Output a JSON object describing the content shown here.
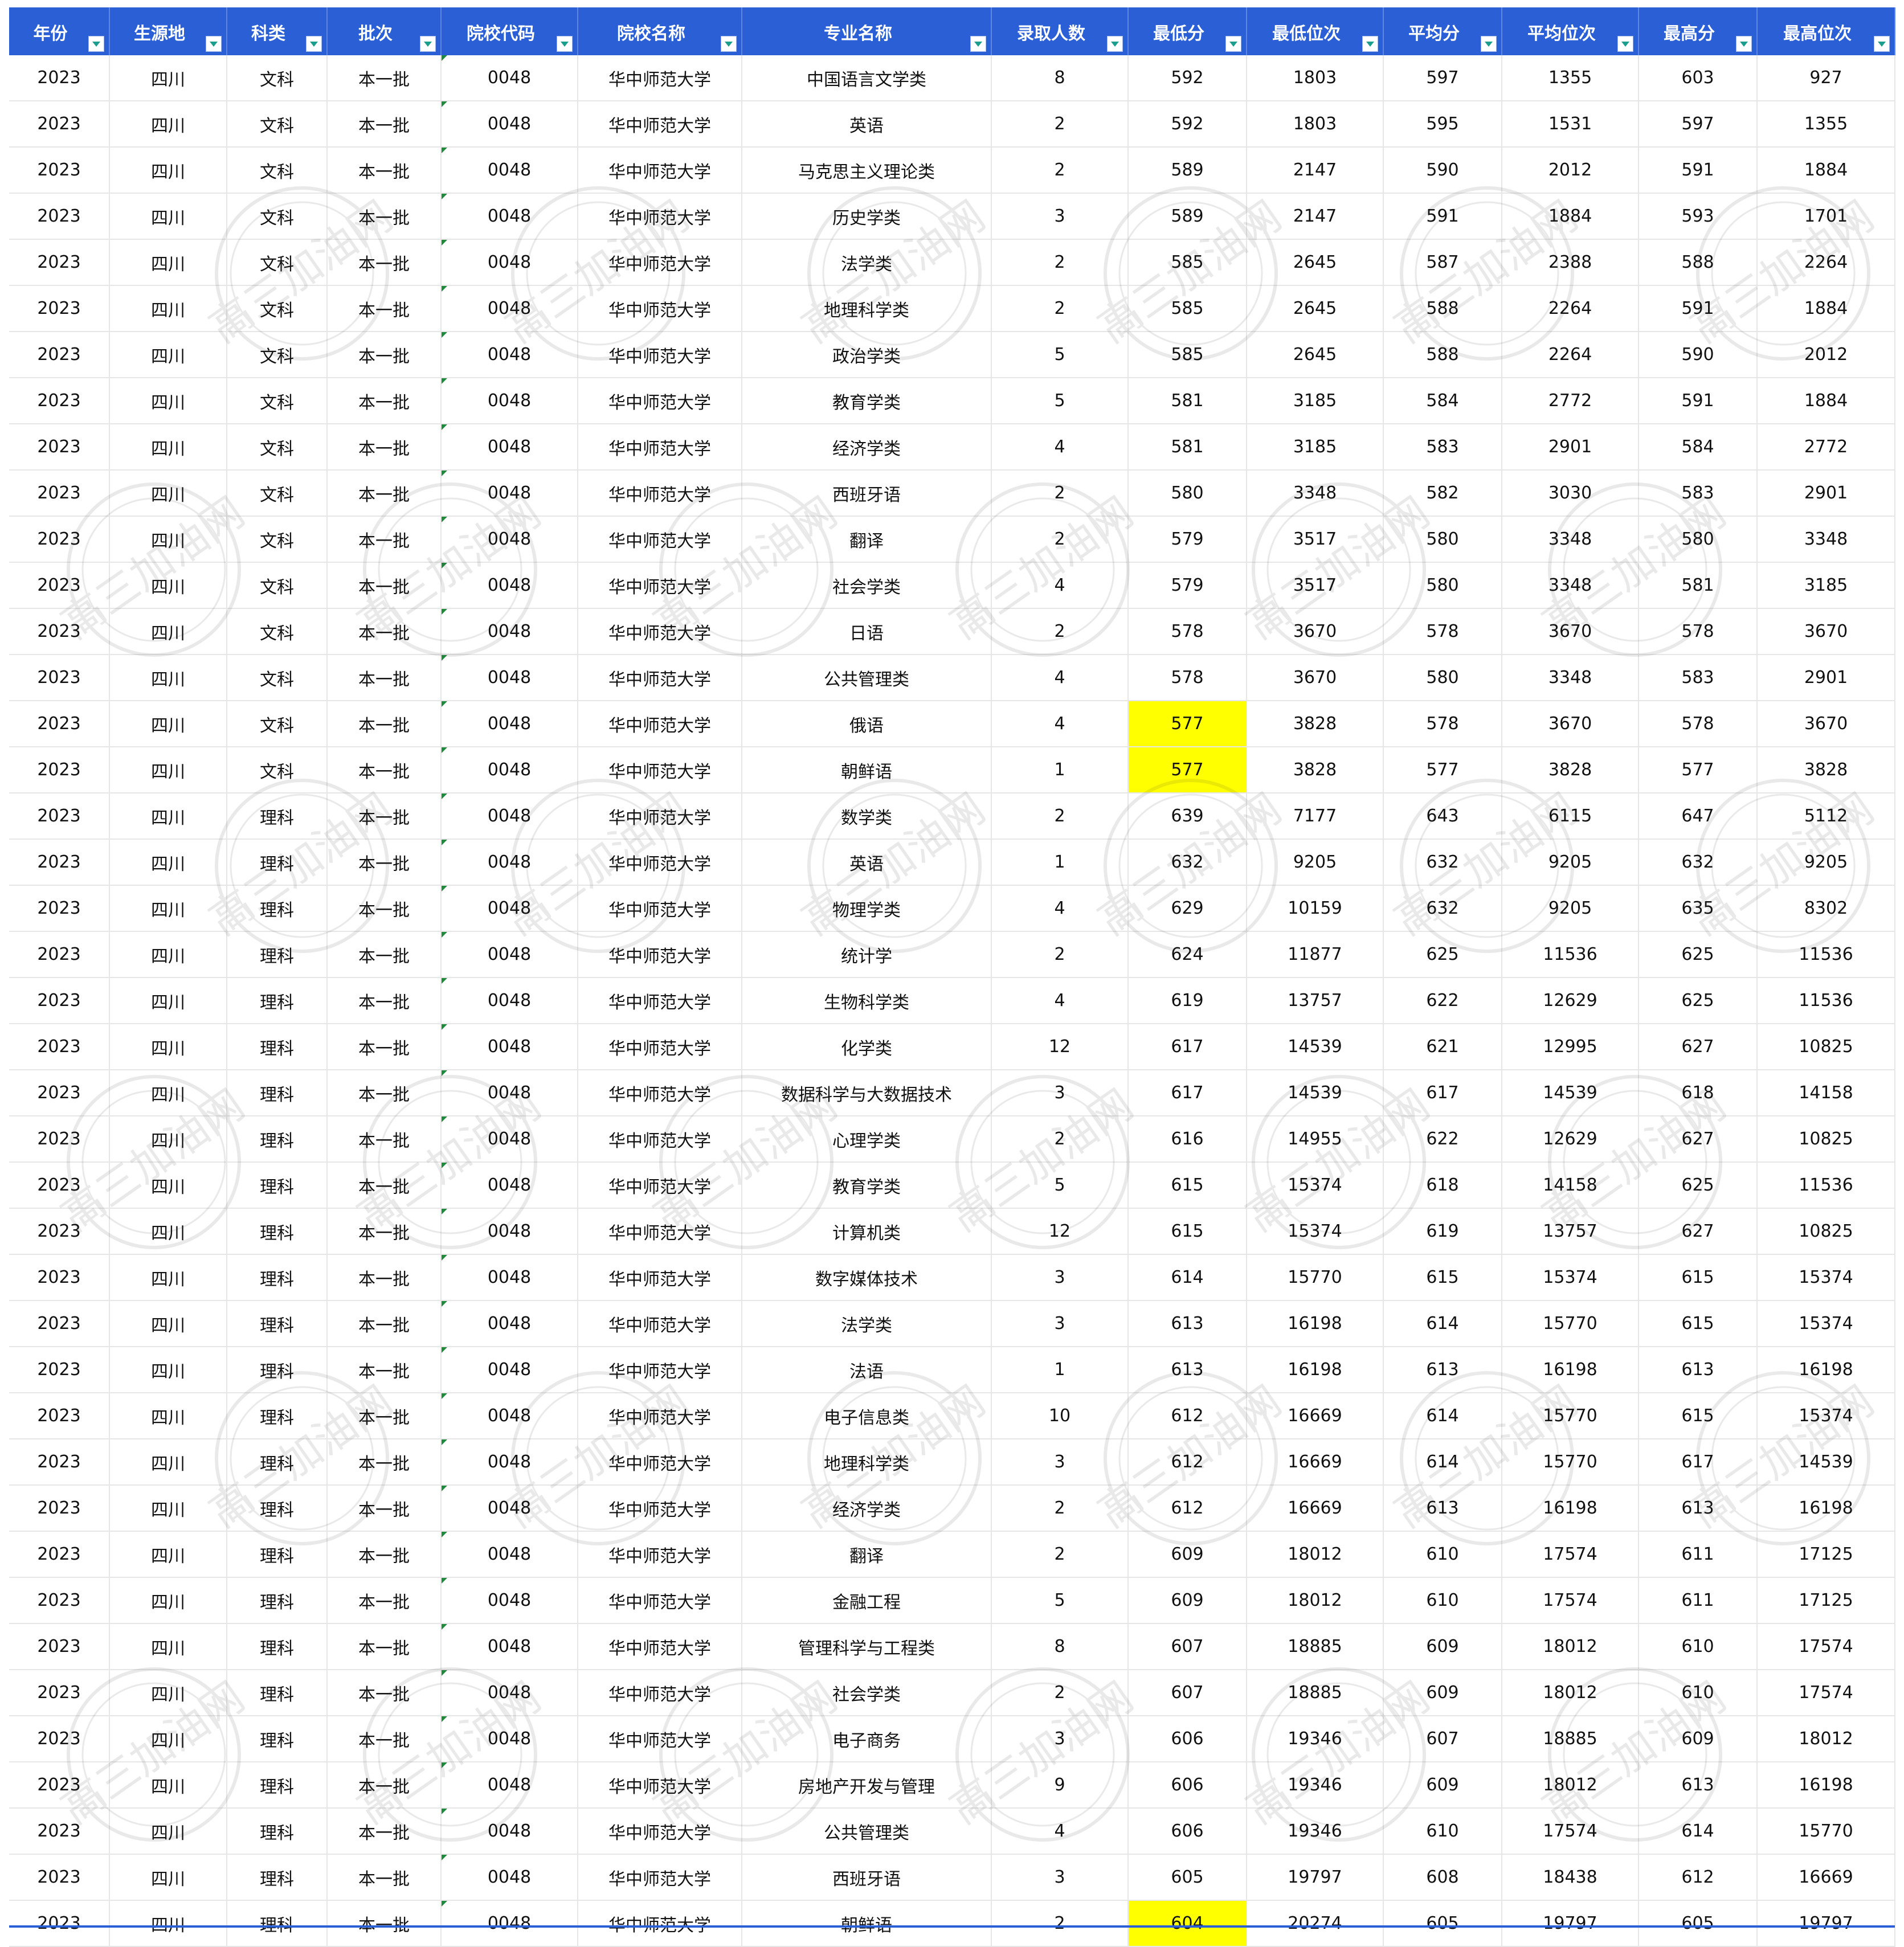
{
  "columns": [
    "年份",
    "生源地",
    "科类",
    "批次",
    "院校代码",
    "院校名称",
    "专业名称",
    "录取人数",
    "最低分",
    "最低位次",
    "平均分",
    "平均位次",
    "最高分",
    "最高位次"
  ],
  "watermark": "高三加油网",
  "highlight_color": "#ffff00",
  "header_color": "#2b5fd6",
  "rows": [
    {
      "cells": [
        "2023",
        "四川",
        "文科",
        "本一批",
        "0048",
        "华中师范大学",
        "中国语言文学类",
        "8",
        "592",
        "1803",
        "597",
        "1355",
        "603",
        "927"
      ],
      "highlight": false
    },
    {
      "cells": [
        "2023",
        "四川",
        "文科",
        "本一批",
        "0048",
        "华中师范大学",
        "英语",
        "2",
        "592",
        "1803",
        "595",
        "1531",
        "597",
        "1355"
      ],
      "highlight": false
    },
    {
      "cells": [
        "2023",
        "四川",
        "文科",
        "本一批",
        "0048",
        "华中师范大学",
        "马克思主义理论类",
        "2",
        "589",
        "2147",
        "590",
        "2012",
        "591",
        "1884"
      ],
      "highlight": false
    },
    {
      "cells": [
        "2023",
        "四川",
        "文科",
        "本一批",
        "0048",
        "华中师范大学",
        "历史学类",
        "3",
        "589",
        "2147",
        "591",
        "1884",
        "593",
        "1701"
      ],
      "highlight": false
    },
    {
      "cells": [
        "2023",
        "四川",
        "文科",
        "本一批",
        "0048",
        "华中师范大学",
        "法学类",
        "2",
        "585",
        "2645",
        "587",
        "2388",
        "588",
        "2264"
      ],
      "highlight": false
    },
    {
      "cells": [
        "2023",
        "四川",
        "文科",
        "本一批",
        "0048",
        "华中师范大学",
        "地理科学类",
        "2",
        "585",
        "2645",
        "588",
        "2264",
        "591",
        "1884"
      ],
      "highlight": false
    },
    {
      "cells": [
        "2023",
        "四川",
        "文科",
        "本一批",
        "0048",
        "华中师范大学",
        "政治学类",
        "5",
        "585",
        "2645",
        "588",
        "2264",
        "590",
        "2012"
      ],
      "highlight": false
    },
    {
      "cells": [
        "2023",
        "四川",
        "文科",
        "本一批",
        "0048",
        "华中师范大学",
        "教育学类",
        "5",
        "581",
        "3185",
        "584",
        "2772",
        "591",
        "1884"
      ],
      "highlight": false
    },
    {
      "cells": [
        "2023",
        "四川",
        "文科",
        "本一批",
        "0048",
        "华中师范大学",
        "经济学类",
        "4",
        "581",
        "3185",
        "583",
        "2901",
        "584",
        "2772"
      ],
      "highlight": false
    },
    {
      "cells": [
        "2023",
        "四川",
        "文科",
        "本一批",
        "0048",
        "华中师范大学",
        "西班牙语",
        "2",
        "580",
        "3348",
        "582",
        "3030",
        "583",
        "2901"
      ],
      "highlight": false
    },
    {
      "cells": [
        "2023",
        "四川",
        "文科",
        "本一批",
        "0048",
        "华中师范大学",
        "翻译",
        "2",
        "579",
        "3517",
        "580",
        "3348",
        "580",
        "3348"
      ],
      "highlight": false
    },
    {
      "cells": [
        "2023",
        "四川",
        "文科",
        "本一批",
        "0048",
        "华中师范大学",
        "社会学类",
        "4",
        "579",
        "3517",
        "580",
        "3348",
        "581",
        "3185"
      ],
      "highlight": false
    },
    {
      "cells": [
        "2023",
        "四川",
        "文科",
        "本一批",
        "0048",
        "华中师范大学",
        "日语",
        "2",
        "578",
        "3670",
        "578",
        "3670",
        "578",
        "3670"
      ],
      "highlight": false
    },
    {
      "cells": [
        "2023",
        "四川",
        "文科",
        "本一批",
        "0048",
        "华中师范大学",
        "公共管理类",
        "4",
        "578",
        "3670",
        "580",
        "3348",
        "583",
        "2901"
      ],
      "highlight": false
    },
    {
      "cells": [
        "2023",
        "四川",
        "文科",
        "本一批",
        "0048",
        "华中师范大学",
        "俄语",
        "4",
        "577",
        "3828",
        "578",
        "3670",
        "578",
        "3670"
      ],
      "highlight": true
    },
    {
      "cells": [
        "2023",
        "四川",
        "文科",
        "本一批",
        "0048",
        "华中师范大学",
        "朝鲜语",
        "1",
        "577",
        "3828",
        "577",
        "3828",
        "577",
        "3828"
      ],
      "highlight": true
    },
    {
      "cells": [
        "2023",
        "四川",
        "理科",
        "本一批",
        "0048",
        "华中师范大学",
        "数学类",
        "2",
        "639",
        "7177",
        "643",
        "6115",
        "647",
        "5112"
      ],
      "highlight": false
    },
    {
      "cells": [
        "2023",
        "四川",
        "理科",
        "本一批",
        "0048",
        "华中师范大学",
        "英语",
        "1",
        "632",
        "9205",
        "632",
        "9205",
        "632",
        "9205"
      ],
      "highlight": false
    },
    {
      "cells": [
        "2023",
        "四川",
        "理科",
        "本一批",
        "0048",
        "华中师范大学",
        "物理学类",
        "4",
        "629",
        "10159",
        "632",
        "9205",
        "635",
        "8302"
      ],
      "highlight": false
    },
    {
      "cells": [
        "2023",
        "四川",
        "理科",
        "本一批",
        "0048",
        "华中师范大学",
        "统计学",
        "2",
        "624",
        "11877",
        "625",
        "11536",
        "625",
        "11536"
      ],
      "highlight": false
    },
    {
      "cells": [
        "2023",
        "四川",
        "理科",
        "本一批",
        "0048",
        "华中师范大学",
        "生物科学类",
        "4",
        "619",
        "13757",
        "622",
        "12629",
        "625",
        "11536"
      ],
      "highlight": false
    },
    {
      "cells": [
        "2023",
        "四川",
        "理科",
        "本一批",
        "0048",
        "华中师范大学",
        "化学类",
        "12",
        "617",
        "14539",
        "621",
        "12995",
        "627",
        "10825"
      ],
      "highlight": false
    },
    {
      "cells": [
        "2023",
        "四川",
        "理科",
        "本一批",
        "0048",
        "华中师范大学",
        "数据科学与大数据技术",
        "3",
        "617",
        "14539",
        "617",
        "14539",
        "618",
        "14158"
      ],
      "highlight": false
    },
    {
      "cells": [
        "2023",
        "四川",
        "理科",
        "本一批",
        "0048",
        "华中师范大学",
        "心理学类",
        "2",
        "616",
        "14955",
        "622",
        "12629",
        "627",
        "10825"
      ],
      "highlight": false
    },
    {
      "cells": [
        "2023",
        "四川",
        "理科",
        "本一批",
        "0048",
        "华中师范大学",
        "教育学类",
        "5",
        "615",
        "15374",
        "618",
        "14158",
        "625",
        "11536"
      ],
      "highlight": false
    },
    {
      "cells": [
        "2023",
        "四川",
        "理科",
        "本一批",
        "0048",
        "华中师范大学",
        "计算机类",
        "12",
        "615",
        "15374",
        "619",
        "13757",
        "627",
        "10825"
      ],
      "highlight": false
    },
    {
      "cells": [
        "2023",
        "四川",
        "理科",
        "本一批",
        "0048",
        "华中师范大学",
        "数字媒体技术",
        "3",
        "614",
        "15770",
        "615",
        "15374",
        "615",
        "15374"
      ],
      "highlight": false
    },
    {
      "cells": [
        "2023",
        "四川",
        "理科",
        "本一批",
        "0048",
        "华中师范大学",
        "法学类",
        "3",
        "613",
        "16198",
        "614",
        "15770",
        "615",
        "15374"
      ],
      "highlight": false
    },
    {
      "cells": [
        "2023",
        "四川",
        "理科",
        "本一批",
        "0048",
        "华中师范大学",
        "法语",
        "1",
        "613",
        "16198",
        "613",
        "16198",
        "613",
        "16198"
      ],
      "highlight": false
    },
    {
      "cells": [
        "2023",
        "四川",
        "理科",
        "本一批",
        "0048",
        "华中师范大学",
        "电子信息类",
        "10",
        "612",
        "16669",
        "614",
        "15770",
        "615",
        "15374"
      ],
      "highlight": false
    },
    {
      "cells": [
        "2023",
        "四川",
        "理科",
        "本一批",
        "0048",
        "华中师范大学",
        "地理科学类",
        "3",
        "612",
        "16669",
        "614",
        "15770",
        "617",
        "14539"
      ],
      "highlight": false
    },
    {
      "cells": [
        "2023",
        "四川",
        "理科",
        "本一批",
        "0048",
        "华中师范大学",
        "经济学类",
        "2",
        "612",
        "16669",
        "613",
        "16198",
        "613",
        "16198"
      ],
      "highlight": false
    },
    {
      "cells": [
        "2023",
        "四川",
        "理科",
        "本一批",
        "0048",
        "华中师范大学",
        "翻译",
        "2",
        "609",
        "18012",
        "610",
        "17574",
        "611",
        "17125"
      ],
      "highlight": false
    },
    {
      "cells": [
        "2023",
        "四川",
        "理科",
        "本一批",
        "0048",
        "华中师范大学",
        "金融工程",
        "5",
        "609",
        "18012",
        "610",
        "17574",
        "611",
        "17125"
      ],
      "highlight": false
    },
    {
      "cells": [
        "2023",
        "四川",
        "理科",
        "本一批",
        "0048",
        "华中师范大学",
        "管理科学与工程类",
        "8",
        "607",
        "18885",
        "609",
        "18012",
        "610",
        "17574"
      ],
      "highlight": false
    },
    {
      "cells": [
        "2023",
        "四川",
        "理科",
        "本一批",
        "0048",
        "华中师范大学",
        "社会学类",
        "2",
        "607",
        "18885",
        "609",
        "18012",
        "610",
        "17574"
      ],
      "highlight": false
    },
    {
      "cells": [
        "2023",
        "四川",
        "理科",
        "本一批",
        "0048",
        "华中师范大学",
        "电子商务",
        "3",
        "606",
        "19346",
        "607",
        "18885",
        "609",
        "18012"
      ],
      "highlight": false
    },
    {
      "cells": [
        "2023",
        "四川",
        "理科",
        "本一批",
        "0048",
        "华中师范大学",
        "房地产开发与管理",
        "9",
        "606",
        "19346",
        "609",
        "18012",
        "613",
        "16198"
      ],
      "highlight": false
    },
    {
      "cells": [
        "2023",
        "四川",
        "理科",
        "本一批",
        "0048",
        "华中师范大学",
        "公共管理类",
        "4",
        "606",
        "19346",
        "610",
        "17574",
        "614",
        "15770"
      ],
      "highlight": false
    },
    {
      "cells": [
        "2023",
        "四川",
        "理科",
        "本一批",
        "0048",
        "华中师范大学",
        "西班牙语",
        "3",
        "605",
        "19797",
        "608",
        "18438",
        "612",
        "16669"
      ],
      "highlight": false
    },
    {
      "cells": [
        "2023",
        "四川",
        "理科",
        "本一批",
        "0048",
        "华中师范大学",
        "朝鲜语",
        "2",
        "604",
        "20274",
        "605",
        "19797",
        "605",
        "19797"
      ],
      "highlight": true
    }
  ]
}
